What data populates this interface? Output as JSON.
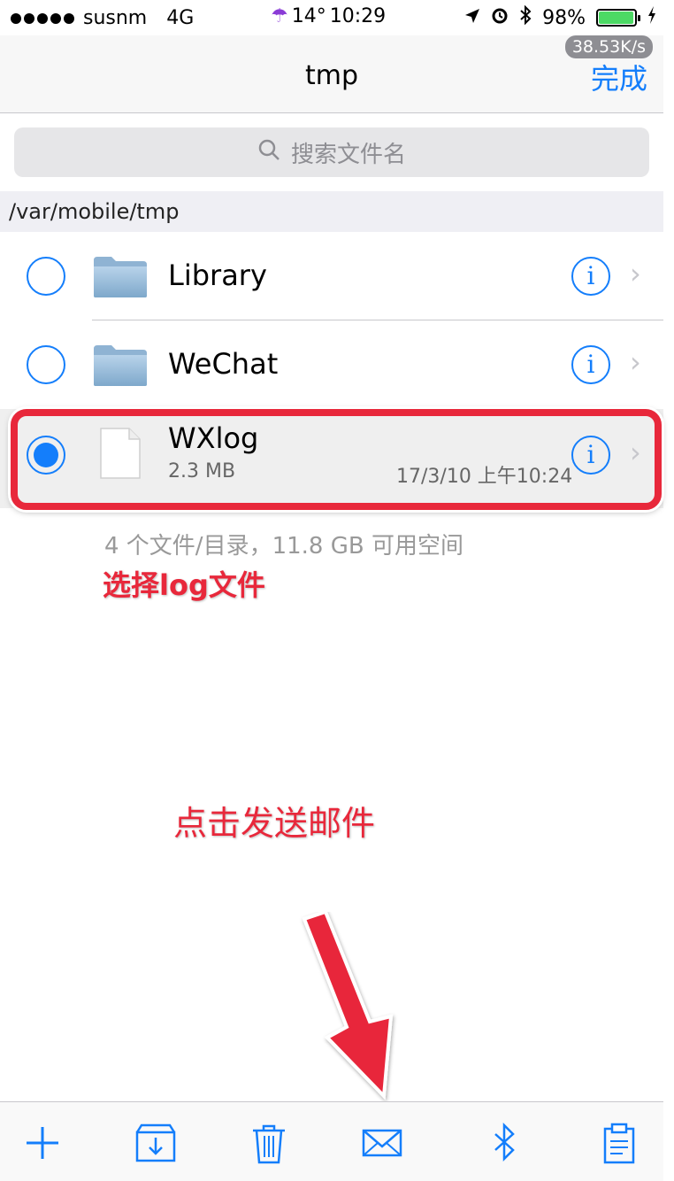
{
  "status": {
    "carrier": "susnm",
    "network": "4G",
    "weather_temp": "14°",
    "time": "10:29",
    "battery": "98%",
    "battery_level": 0.98,
    "speed": "38.53K/s"
  },
  "nav": {
    "title": "tmp",
    "done_label": "完成"
  },
  "search": {
    "placeholder": "搜索文件名"
  },
  "path": "/var/mobile/tmp",
  "files": [
    {
      "name": "Library",
      "type": "folder",
      "selected": false
    },
    {
      "name": "WeChat",
      "type": "folder",
      "selected": false
    },
    {
      "name": "WXlog",
      "type": "file",
      "size": "2.3 MB",
      "date": "17/3/10 上午10:24",
      "selected": true
    }
  ],
  "footer_info": "4 个文件/目录，11.8 GB 可用空间",
  "annotations": {
    "select_log": "选择log文件",
    "tap_send_mail": "点击发送邮件"
  },
  "colors": {
    "accent": "#147efb",
    "annotation": "#e8283b",
    "battery": "#4cd964"
  },
  "toolbar": {
    "icons": [
      "plus-icon",
      "import-icon",
      "trash-icon",
      "mail-icon",
      "bluetooth-icon",
      "clipboard-icon"
    ]
  }
}
